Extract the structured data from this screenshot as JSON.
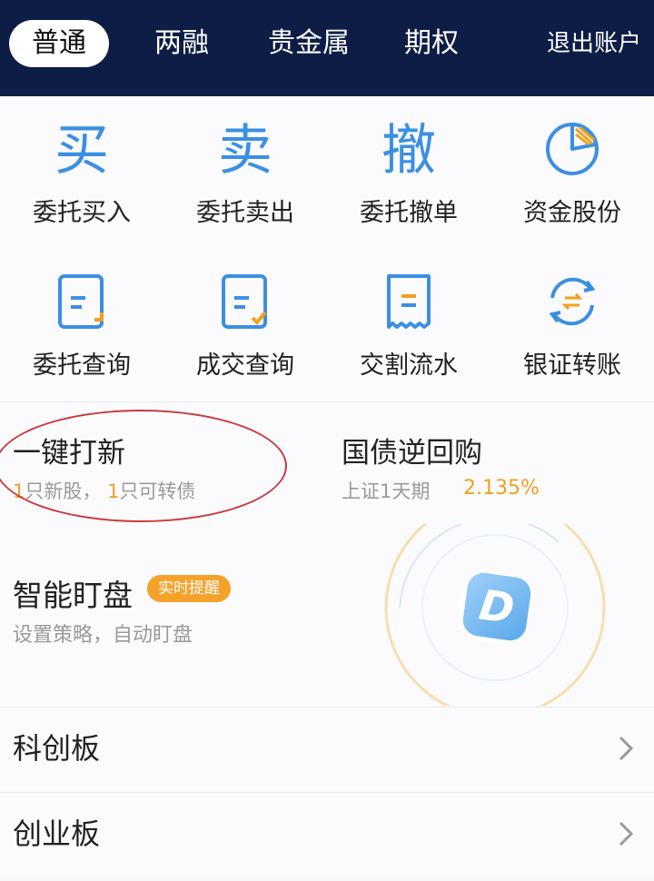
{
  "nav": {
    "tabs": [
      "普通",
      "两融",
      "贵金属",
      "期权"
    ],
    "logout": "退出账户"
  },
  "actions": [
    {
      "glyph": "买",
      "label": "委托买入"
    },
    {
      "glyph": "卖",
      "label": "委托卖出"
    },
    {
      "glyph": "撤",
      "label": "委托撤单"
    },
    {
      "icon": "pie-chart-icon",
      "label": "资金股份"
    },
    {
      "icon": "document-order-icon",
      "label": "委托查询"
    },
    {
      "icon": "document-check-icon",
      "label": "成交查询"
    },
    {
      "icon": "receipt-icon",
      "label": "交割流水"
    },
    {
      "icon": "transfer-exchange-icon",
      "label": "银证转账"
    }
  ],
  "ipo": {
    "title": "一键打新",
    "sub_parts": [
      "1",
      "只新股，",
      "1",
      "只可转债"
    ]
  },
  "repo": {
    "title": "国债逆回购",
    "sub": "上证1天期",
    "rate": "2.135%"
  },
  "watch": {
    "title": "智能盯盘",
    "badge": "实时提醒",
    "sub": "设置策略，自动盯盘",
    "logo_letter": "D"
  },
  "boards": [
    "科创板",
    "创业板"
  ],
  "colors": {
    "nav_bg": "#0d1d45",
    "accent_blue": "#3b8fe3",
    "accent_orange": "#f0a020"
  }
}
